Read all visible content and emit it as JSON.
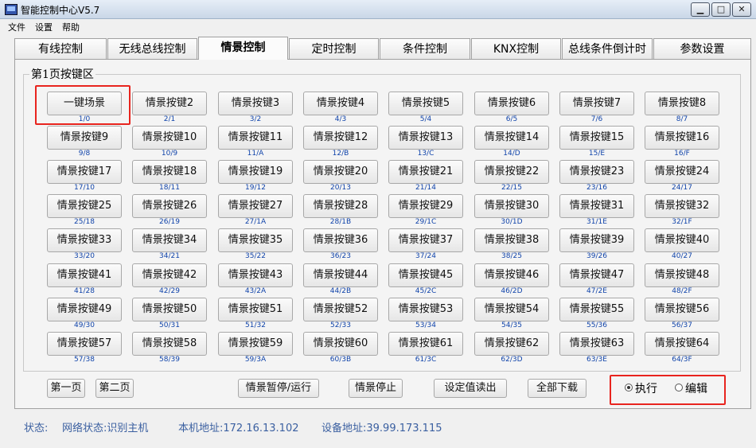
{
  "window": {
    "title": "智能控制中心V5.7"
  },
  "menu": [
    "文件",
    "设置",
    "帮助"
  ],
  "tabs": [
    "有线控制",
    "无线总线控制",
    "情景控制",
    "定时控制",
    "条件控制",
    "KNX控制",
    "总线条件倒计时",
    "参数设置"
  ],
  "active_tab": 2,
  "group_title": "第1页按键区",
  "scene_buttons": [
    {
      "label": "一键场景",
      "addr": "1/0"
    },
    {
      "label": "情景按键2",
      "addr": "2/1"
    },
    {
      "label": "情景按键3",
      "addr": "3/2"
    },
    {
      "label": "情景按键4",
      "addr": "4/3"
    },
    {
      "label": "情景按键5",
      "addr": "5/4"
    },
    {
      "label": "情景按键6",
      "addr": "6/5"
    },
    {
      "label": "情景按键7",
      "addr": "7/6"
    },
    {
      "label": "情景按键8",
      "addr": "8/7"
    },
    {
      "label": "情景按键9",
      "addr": "9/8"
    },
    {
      "label": "情景按键10",
      "addr": "10/9"
    },
    {
      "label": "情景按键11",
      "addr": "11/A"
    },
    {
      "label": "情景按键12",
      "addr": "12/B"
    },
    {
      "label": "情景按键13",
      "addr": "13/C"
    },
    {
      "label": "情景按键14",
      "addr": "14/D"
    },
    {
      "label": "情景按键15",
      "addr": "15/E"
    },
    {
      "label": "情景按键16",
      "addr": "16/F"
    },
    {
      "label": "情景按键17",
      "addr": "17/10"
    },
    {
      "label": "情景按键18",
      "addr": "18/11"
    },
    {
      "label": "情景按键19",
      "addr": "19/12"
    },
    {
      "label": "情景按键20",
      "addr": "20/13"
    },
    {
      "label": "情景按键21",
      "addr": "21/14"
    },
    {
      "label": "情景按键22",
      "addr": "22/15"
    },
    {
      "label": "情景按键23",
      "addr": "23/16"
    },
    {
      "label": "情景按键24",
      "addr": "24/17"
    },
    {
      "label": "情景按键25",
      "addr": "25/18"
    },
    {
      "label": "情景按键26",
      "addr": "26/19"
    },
    {
      "label": "情景按键27",
      "addr": "27/1A"
    },
    {
      "label": "情景按键28",
      "addr": "28/1B"
    },
    {
      "label": "情景按键29",
      "addr": "29/1C"
    },
    {
      "label": "情景按键30",
      "addr": "30/1D"
    },
    {
      "label": "情景按键31",
      "addr": "31/1E"
    },
    {
      "label": "情景按键32",
      "addr": "32/1F"
    },
    {
      "label": "情景按键33",
      "addr": "33/20"
    },
    {
      "label": "情景按键34",
      "addr": "34/21"
    },
    {
      "label": "情景按键35",
      "addr": "35/22"
    },
    {
      "label": "情景按键36",
      "addr": "36/23"
    },
    {
      "label": "情景按键37",
      "addr": "37/24"
    },
    {
      "label": "情景按键38",
      "addr": "38/25"
    },
    {
      "label": "情景按键39",
      "addr": "39/26"
    },
    {
      "label": "情景按键40",
      "addr": "40/27"
    },
    {
      "label": "情景按键41",
      "addr": "41/28"
    },
    {
      "label": "情景按键42",
      "addr": "42/29"
    },
    {
      "label": "情景按键43",
      "addr": "43/2A"
    },
    {
      "label": "情景按键44",
      "addr": "44/2B"
    },
    {
      "label": "情景按键45",
      "addr": "45/2C"
    },
    {
      "label": "情景按键46",
      "addr": "46/2D"
    },
    {
      "label": "情景按键47",
      "addr": "47/2E"
    },
    {
      "label": "情景按键48",
      "addr": "48/2F"
    },
    {
      "label": "情景按键49",
      "addr": "49/30"
    },
    {
      "label": "情景按键50",
      "addr": "50/31"
    },
    {
      "label": "情景按键51",
      "addr": "51/32"
    },
    {
      "label": "情景按键52",
      "addr": "52/33"
    },
    {
      "label": "情景按键53",
      "addr": "53/34"
    },
    {
      "label": "情景按键54",
      "addr": "54/35"
    },
    {
      "label": "情景按键55",
      "addr": "55/36"
    },
    {
      "label": "情景按键56",
      "addr": "56/37"
    },
    {
      "label": "情景按键57",
      "addr": "57/38"
    },
    {
      "label": "情景按键58",
      "addr": "58/39"
    },
    {
      "label": "情景按键59",
      "addr": "59/3A"
    },
    {
      "label": "情景按键60",
      "addr": "60/3B"
    },
    {
      "label": "情景按键61",
      "addr": "61/3C"
    },
    {
      "label": "情景按键62",
      "addr": "62/3D"
    },
    {
      "label": "情景按键63",
      "addr": "63/3E"
    },
    {
      "label": "情景按键64",
      "addr": "64/3F"
    }
  ],
  "bottom_buttons": {
    "page1": "第一页",
    "page2": "第二页",
    "pause_run": "情景暂停/运行",
    "stop": "情景停止",
    "read": "设定值读出",
    "download": "全部下载"
  },
  "mode": {
    "execute": "执行",
    "edit": "编辑",
    "selected": "execute"
  },
  "status": {
    "label": "状态:",
    "network": "网络状态:识别主机",
    "local": "本机地址:172.16.13.102",
    "device": "设备地址:39.99.173.115"
  },
  "colors": {
    "highlight": "#e8241e",
    "addr_text": "#1144aa",
    "status_text": "#3a5fa0"
  }
}
